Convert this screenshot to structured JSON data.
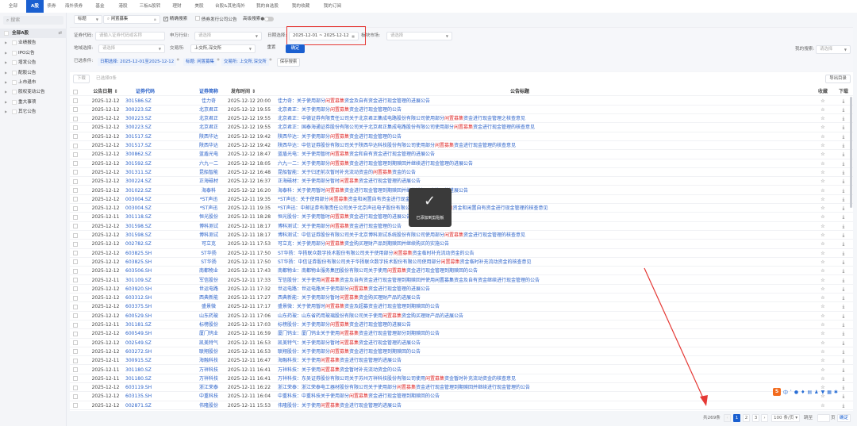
{
  "tabs": [
    "全部",
    "A股",
    "债券",
    "海外债券",
    "基金",
    "港股",
    "三板&股转",
    "理财",
    "美股",
    "台股&其他海外",
    "我的自选股",
    "我的收藏",
    "我的订阅"
  ],
  "active_tab": "A股",
  "sidebar": {
    "search_placeholder": "搜索",
    "items": [
      "全部A股",
      "业绩报告",
      "IPO公告",
      "增发公告",
      "配股公告",
      "上市退市",
      "股权变动公告",
      "重大事项",
      "其它公告"
    ]
  },
  "search": {
    "field_select": "标题",
    "query": "闲置募集",
    "exact_label": "精确搜索",
    "exact_checked": true,
    "bond_label": "债券发行公司公告",
    "advanced_label": "高级搜索"
  },
  "filters": {
    "code_label": "证券代码:",
    "code_placeholder": "请输入证券代码或名称",
    "industry_label": "申万行业:",
    "industry_placeholder": "请选择",
    "date_label": "日期选择:",
    "date_start": "2025-12-01",
    "date_sep": "~",
    "date_end": "2025-12-12",
    "market_label": "板块市场:",
    "market_placeholder": "请选择",
    "region_label": "地域选择:",
    "region_placeholder": "请选择",
    "exchange_label": "交易所:",
    "exchange_value": "上交所,深交所",
    "reset": "重置",
    "confirm": "确定",
    "my_search_label": "我的搜索:",
    "my_search_placeholder": "请选择"
  },
  "selected": {
    "label": "已选条件:",
    "chips": [
      "日期选择: 2025-12-01至2025-12-12",
      "标题: 闲置募集",
      "交易所: 上交所,深交所"
    ],
    "save": "保存搜索"
  },
  "toolbar": {
    "download": "下载",
    "selected_count": "已选择0条",
    "export": "导出目录"
  },
  "columns": {
    "date": "公告日期",
    "code": "证券代码",
    "name": "证券简称",
    "time": "发布时间",
    "title": "公告标题",
    "fav": "收藏",
    "dl": "下载"
  },
  "rows": [
    [
      "2025-12-12",
      "301586.SZ",
      "佳力奇",
      "2025-12-12 20:00",
      "佳力奇：关于使用部分",
      "闲置募集",
      "资金及自有资金进行现金管理的进展公告"
    ],
    [
      "2025-12-12",
      "300223.SZ",
      "北京君正",
      "2025-12-12 19:55",
      "北京君正：关于使用部分",
      "闲置募集",
      "资金进行现金管理的公告"
    ],
    [
      "2025-12-12",
      "300223.SZ",
      "北京君正",
      "2025-12-12 19:55",
      "北京君正：中德证券有限责任公司关于北京君正集成电路股份有限公司使用部分",
      "闲置募集",
      "资金进行现金管理之核查意见"
    ],
    [
      "2025-12-12",
      "300223.SZ",
      "北京君正",
      "2025-12-12 19:55",
      "北京君正：国泰海通证券股份有限公司关于北京君正集成电路股份有限公司使用部分",
      "闲置募集",
      "资金进行现金管理的核查意见"
    ],
    [
      "2025-12-12",
      "301517.SZ",
      "陕西华达",
      "2025-12-12 19:42",
      "陕西华达：关于使用部分",
      "闲置募集",
      "资金进行现金管理的公告"
    ],
    [
      "2025-12-12",
      "301517.SZ",
      "陕西华达",
      "2025-12-12 19:42",
      "陕西华达：中信证券股份有限公司关于陕西华达科技股份有限公司使用部分",
      "闲置募集",
      "资金进行现金管理的核查意见"
    ],
    [
      "2025-12-12",
      "300862.SZ",
      "蓝盾光电",
      "2025-12-12 18:47",
      "蓝盾光电：关于使用暂时",
      "闲置募集",
      "资金和自有资金进行现金管理的进展公告"
    ],
    [
      "2025-12-12",
      "301592.SZ",
      "六九一二",
      "2025-12-12 18:05",
      "六九一二：关于使用部分",
      "闲置募集",
      "资金进行现金管理到期赎回并继续进行现金管理的进展公告"
    ],
    [
      "2025-12-12",
      "301311.SZ",
      "昆船智能",
      "2025-12-12 16:48",
      "昆船智能：关于归还前次暂时补充流动资金的",
      "闲置募集",
      "资金的公告"
    ],
    [
      "2025-12-12",
      "300224.SZ",
      "正海磁材",
      "2025-12-12 16:37",
      "正海磁材：关于使用部分暂时",
      "闲置募集",
      "资金进行现金管理的进展公告"
    ],
    [
      "2025-12-12",
      "301022.SZ",
      "海泰科",
      "2025-12-12 16:20",
      "海泰科：关于使用暂时",
      "闲置募集",
      "资金进行现金管理到期赎回并继续进行现金管理的进展公告"
    ],
    [
      "2025-12-12",
      "003004.SZ",
      "*ST声迅",
      "2025-12-11 19:35",
      "*ST声迅：关于使用部分",
      "闲置募集",
      "资金和闲置自有资金进行现金管理的公告"
    ],
    [
      "2025-12-12",
      "003004.SZ",
      "*ST声迅",
      "2025-12-11 19:35",
      "*ST声迅：中邮证券有限责任公司关于北京声迅电子股份有限公司使用部分",
      "闲置募集",
      "资金和闲置自有资金进行现金管理的核查意见"
    ],
    [
      "2025-12-11",
      "301118.SZ",
      "恒光股份",
      "2025-12-11 18:28",
      "恒光股份：关于使用暂时",
      "闲置募集",
      "资金进行现金管理的进展公告"
    ],
    [
      "2025-12-12",
      "301598.SZ",
      "博科测试",
      "2025-12-11 18:17",
      "博科测试：关于使用部分",
      "闲置募集",
      "资金进行现金管理的公告"
    ],
    [
      "2025-12-12",
      "301598.SZ",
      "博科测试",
      "2025-12-11 18:17",
      "博科测试：中信证券股份有限公司关于北京博科测试系统股份有限公司使用部分",
      "闲置募集",
      "资金进行现金管理的核查意见"
    ],
    [
      "2025-12-12",
      "002782.SZ",
      "可立克",
      "2025-12-11 17:53",
      "可立克：关于使用部分",
      "闲置募集",
      "资金购买理财产品到期赎回并继续购买的实施公告"
    ],
    [
      "2025-12-12",
      "603825.SH",
      "ST华扬",
      "2025-12-11 17:50",
      "ST华扬：华扬联众数字技术股份有限公司关于使用部分",
      "闲置募集",
      "资金临时补充流动资金的公告"
    ],
    [
      "2025-12-12",
      "603825.SH",
      "ST华扬",
      "2025-12-11 17:50",
      "ST华扬：中信证券股份有限公司关于华扬联众数字技术股份有限公司使用部分",
      "闲置募集",
      "资金临时补充流动资金的核查意见"
    ],
    [
      "2025-12-12",
      "603506.SH",
      "南都物业",
      "2025-12-11 17:43",
      "南都物业：南都物业服务集团股份有限公司关于使用",
      "闲置募集",
      "资金进行现金管理到期赎回的公告"
    ],
    [
      "2025-12-11",
      "301109.SZ",
      "军信股份",
      "2025-12-11 17:33",
      "军信股份：关于使用",
      "闲置募集",
      "资金及自有资金进行现金管理到期赎回并使用闲置募集资金及自有资金继续进行现金管理的公告"
    ],
    [
      "2025-12-12",
      "603920.SH",
      "世运电路",
      "2025-12-11 17:32",
      "世运电路：世运电路关于使用部分",
      "闲置募集",
      "资金进行现金管理的进展公告"
    ],
    [
      "2025-12-12",
      "603312.SH",
      "西典新能",
      "2025-12-11 17:27",
      "西典新能：关于使用部分暂时",
      "闲置募集",
      "资金购买理财产品的进展公告"
    ],
    [
      "2025-12-12",
      "603375.SH",
      "盛景微",
      "2025-12-11 17:17",
      "盛景微：关于使用暂时",
      "闲置募集",
      "资金及超募资金进行现金管理到期赎回的公告"
    ],
    [
      "2025-12-12",
      "600529.SH",
      "山东药玻",
      "2025-12-11 17:06",
      "山东药玻：山东省药用玻璃股份有限公司关于使用",
      "闲置募集",
      "资金购买理财产品的进展公告"
    ],
    [
      "2025-12-11",
      "301181.SZ",
      "标榜股份",
      "2025-12-11 17:03",
      "标榜股份：关于使用部分",
      "闲置募集",
      "资金进行现金管理的进展公告"
    ],
    [
      "2025-12-12",
      "600549.SH",
      "厦门钨业",
      "2025-12-11 16:59",
      "厦门钨业：厦门钨业关于使用",
      "闲置募集",
      "资金进行现金管理部分到期赎回的公告"
    ],
    [
      "2025-12-12",
      "002549.SZ",
      "凯美特气",
      "2025-12-11 16:53",
      "凯美特气：关于使用部分暂时",
      "闲置募集",
      "资金进行现金管理的进展公告"
    ],
    [
      "2025-12-12",
      "603272.SH",
      "联翔股份",
      "2025-12-11 16:53",
      "联翔股份：关于使用部分",
      "闲置募集",
      "资金进行现金管理到期赎回的公告"
    ],
    [
      "2025-12-11",
      "300915.SZ",
      "海融科技",
      "2025-12-11 16:47",
      "海融科技：关于使用",
      "闲置募集",
      "资金进行现金管理的进展公告"
    ],
    [
      "2025-12-11",
      "301180.SZ",
      "万祥科技",
      "2025-12-11 16:41",
      "万祥科技：关于使用",
      "闲置募集",
      "资金暂时补充流动资金的公告"
    ],
    [
      "2025-12-11",
      "301180.SZ",
      "万祥科技",
      "2025-12-11 16:41",
      "万祥科技：东吴证券股份有限公司关于苏州万祥科技股份有限公司使用",
      "闲置募集",
      "资金暂时补充流动资金的核查意见"
    ],
    [
      "2025-12-12",
      "603119.SH",
      "浙江荣泰",
      "2025-12-11 16:22",
      "浙江荣泰：浙江荣泰电工器材股份有限公司关于使用部分",
      "闲置募集",
      "资金进行现金管理到期赎回并继续进行现金管理的公告"
    ],
    [
      "2025-12-12",
      "603135.SH",
      "中重科技",
      "2025-12-11 16:04",
      "中重科技：中重科技关于使用部分",
      "闲置募集",
      "资金进行现金管理到期赎回的公告"
    ],
    [
      "2025-12-12",
      "002871.SZ",
      "伟隆股份",
      "2025-12-11 15:53",
      "伟隆股份：关于使用",
      "闲置募集",
      "资金进行现金管理的进展公告"
    ]
  ],
  "pagination": {
    "total": "共269条",
    "pages": [
      "1",
      "2",
      "3"
    ],
    "current": "1",
    "page_size": "100 条/页",
    "jump_label": "跳至",
    "page_unit": "页",
    "confirm": "确定"
  },
  "toast": "已添加到剪贴板",
  "ime_toolbar": {
    "logo": "S",
    "lang": "中"
  },
  "colors": {
    "brand": "#1a5fd0",
    "highlight": "#e03232",
    "link": "#2b62c9",
    "annotation": "#e53935"
  }
}
